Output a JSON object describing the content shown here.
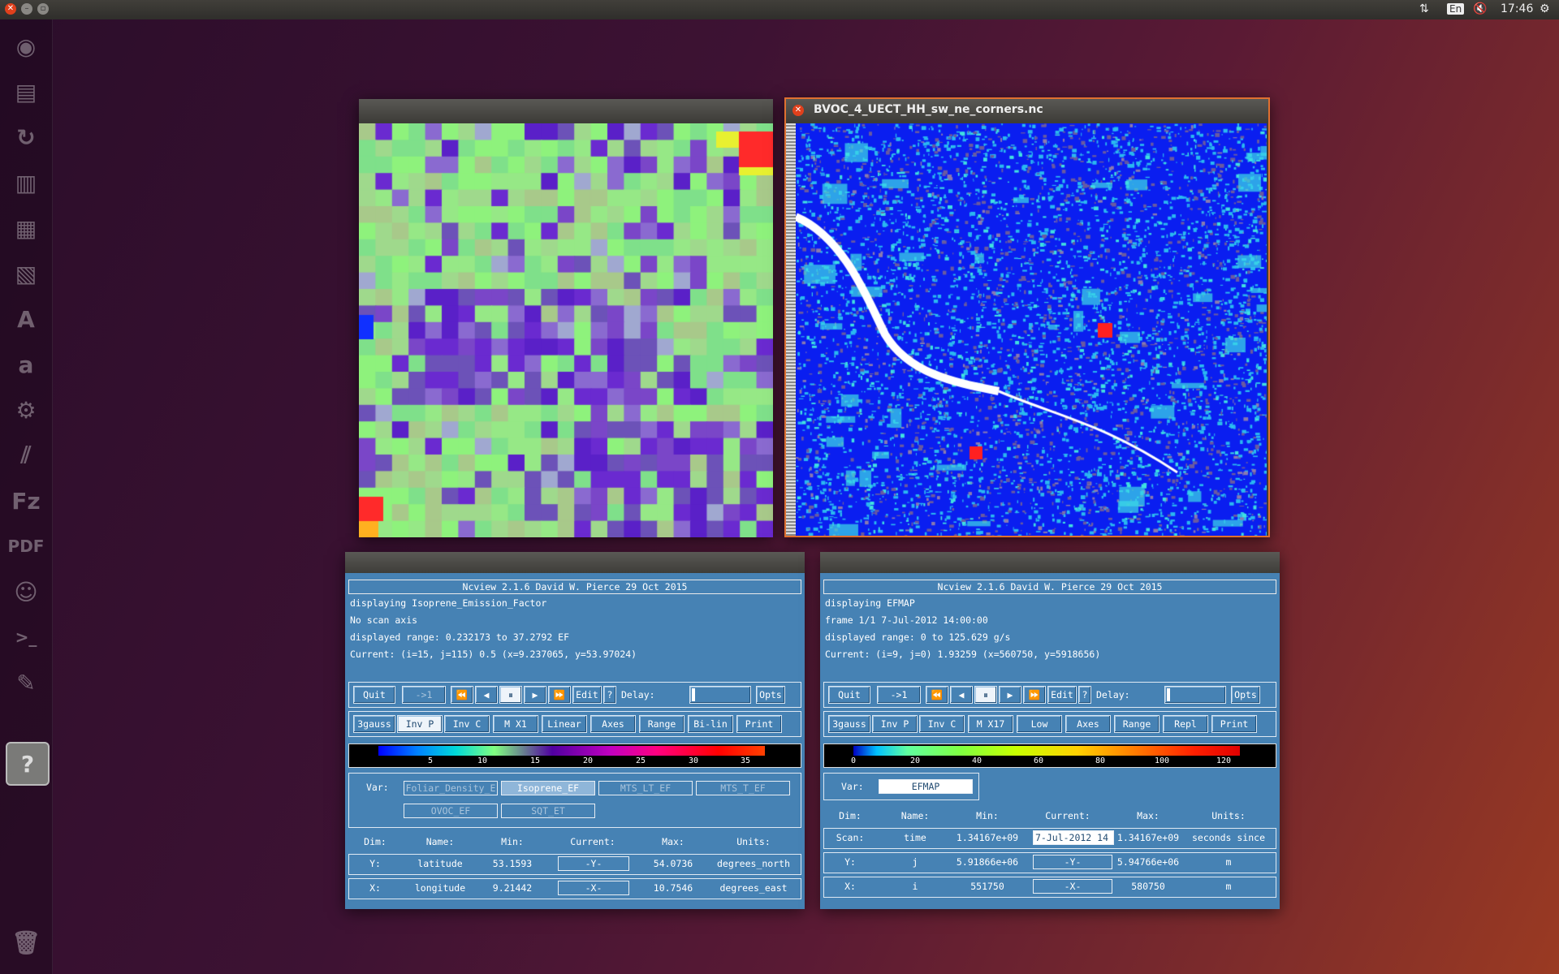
{
  "topbar": {
    "keyboard_layout": "En",
    "clock": "17:46"
  },
  "launcher": {
    "icons": [
      "ubuntu-logo-icon",
      "files-icon",
      "backup-icon",
      "writer-icon",
      "calc-icon",
      "impress-icon",
      "software-center-icon",
      "amazon-icon",
      "settings-icon",
      "stripes-icon",
      "filezilla-icon",
      "pdf-icon",
      "gimp-icon",
      "terminal-icon",
      "text-editor-icon",
      "help-icon",
      "trash-icon"
    ]
  },
  "image_window_right": {
    "title": "BVOC_4_UECT_HH_sw_ne_corners.nc"
  },
  "panel_left": {
    "header": "Ncview 2.1.6 David W. Pierce  29 Oct 2015",
    "info": [
      "displaying Isoprene_Emission_Factor",
      "No scan axis",
      "displayed range: 0.232173 to 37.2792 EF",
      "Current: (i=15, j=115) 0.5 (x=9.237065, y=53.97024)"
    ],
    "buttons1": {
      "quit": "Quit",
      "step": "->1",
      "edit": "Edit",
      "help": "?",
      "delay": "Delay:",
      "opts": "Opts"
    },
    "buttons2": [
      "3gauss",
      "Inv P",
      "Inv C",
      "M X1",
      "Linear",
      "Axes",
      "Range",
      "Bi-lin",
      "Print"
    ],
    "colorbar_ticks": [
      "5",
      "10",
      "15",
      "20",
      "25",
      "30",
      "35"
    ],
    "var_label": "Var:",
    "vars": [
      "Foliar_Density_E",
      "Isoprene_EF",
      "MTS_LT_EF",
      "MTS_T_EF",
      "OVOC_EF",
      "SQT_ET"
    ],
    "dim_headers": [
      "Dim:",
      "Name:",
      "Min:",
      "Current:",
      "Max:",
      "Units:"
    ],
    "dims": [
      {
        "dim": "Y:",
        "name": "latitude",
        "min": "53.1593",
        "current": "-Y-",
        "max": "54.0736",
        "units": "degrees_north"
      },
      {
        "dim": "X:",
        "name": "longitude",
        "min": "9.21442",
        "current": "-X-",
        "max": "10.7546",
        "units": "degrees_east"
      }
    ]
  },
  "panel_right": {
    "header": "Ncview 2.1.6 David W. Pierce  29 Oct 2015",
    "info": [
      "displaying EFMAP",
      "frame 1/1 7-Jul-2012 14:00:00",
      "displayed range: 0 to 125.629 g/s",
      "Current: (i=9, j=0) 1.93259 (x=560750, y=5918656)"
    ],
    "buttons1": {
      "quit": "Quit",
      "step": "->1",
      "edit": "Edit",
      "help": "?",
      "delay": "Delay:",
      "opts": "Opts"
    },
    "buttons2": [
      "3gauss",
      "Inv P",
      "Inv C",
      "M X17",
      "Low",
      "Axes",
      "Range",
      "Repl",
      "Print"
    ],
    "colorbar_ticks": [
      "0",
      "20",
      "40",
      "60",
      "80",
      "100",
      "120"
    ],
    "var_label": "Var:",
    "vars": [
      "EFMAP"
    ],
    "dim_headers": [
      "Dim:",
      "Name:",
      "Min:",
      "Current:",
      "Max:",
      "Units:"
    ],
    "dims": [
      {
        "dim": "Scan:",
        "name": "time",
        "min": "1.34167e+09",
        "current": "7-Jul-2012 14",
        "max": "1.34167e+09",
        "units": "seconds since"
      },
      {
        "dim": "Y:",
        "name": "j",
        "min": "5.91866e+06",
        "current": "-Y-",
        "max": "5.94766e+06",
        "units": "m"
      },
      {
        "dim": "X:",
        "name": "i",
        "min": "551750",
        "current": "-X-",
        "max": "580750",
        "units": "m"
      }
    ]
  },
  "colors": {
    "panel_bg": "#4682b4",
    "accent_red": "#e0401c"
  }
}
